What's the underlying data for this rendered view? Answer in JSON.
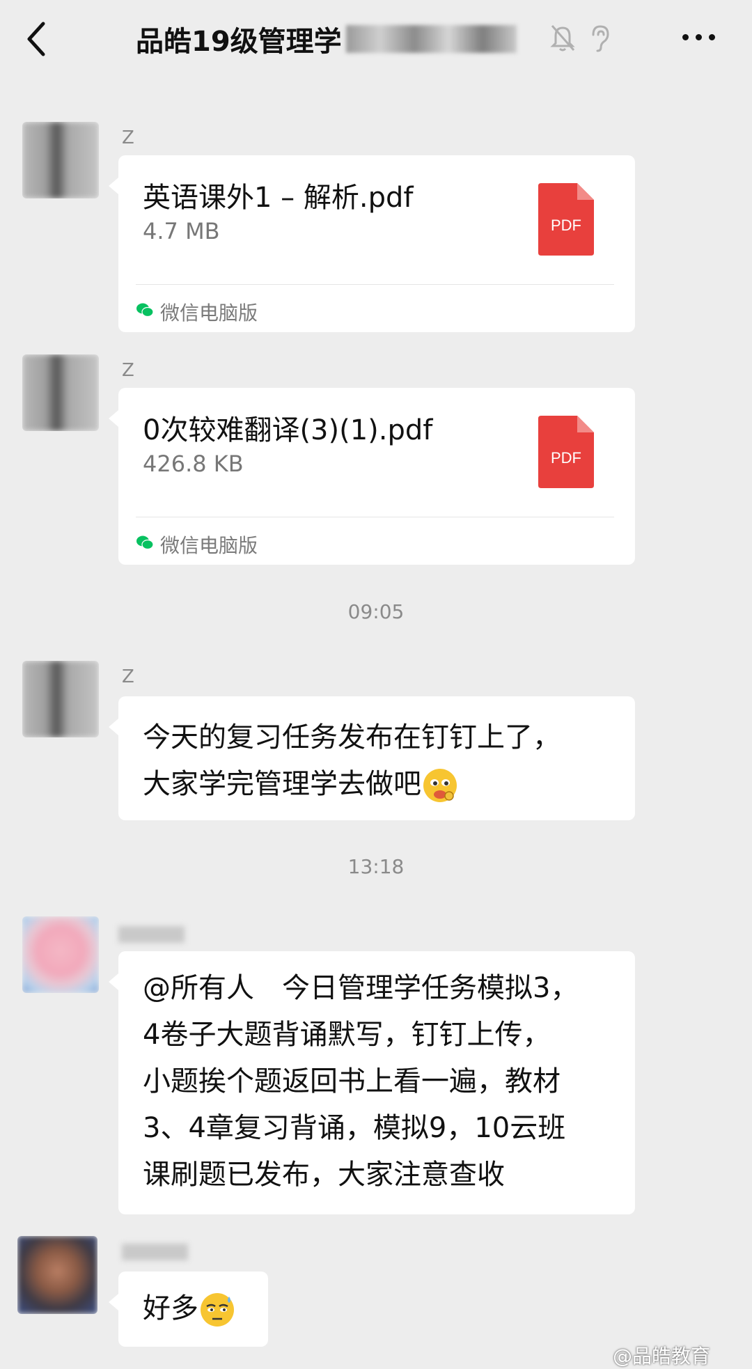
{
  "header": {
    "title": "品皓19级管理学"
  },
  "messages": [
    {
      "sender": "Z",
      "file_name": "英语课外1 – 解析.pdf",
      "file_size": "4.7 MB",
      "file_type": "PDF",
      "source": "微信电脑版"
    },
    {
      "sender": "Z",
      "file_name": "0次较难翻译(3)(1).pdf",
      "file_size": "426.8 KB",
      "file_type": "PDF",
      "source": "微信电脑版"
    },
    {
      "time": "09:05"
    },
    {
      "sender": "Z",
      "lines": [
        "今天的复习任务发布在钉钉上了，",
        "大家学完管理学去做吧"
      ]
    },
    {
      "time": "13:18"
    },
    {
      "lines": [
        "@所有人　今日管理学任务模拟3，",
        "4卷子大题背诵默写，钉钉上传，",
        "小题挨个题返回书上看一遍，教材",
        "3、4章复习背诵，模拟9，10云班",
        "课刷题已发布，大家注意查收"
      ]
    },
    {
      "text": "好多"
    }
  ],
  "watermark": "@品皓教育",
  "colors": {
    "background": "#ededed",
    "bubble": "#ffffff",
    "pdf_red": "#e8403d",
    "wechat_green": "#07c160"
  },
  "icons": [
    "back-arrow-icon",
    "mute-bell-icon",
    "ear-icon",
    "more-icon",
    "pdf-file-icon",
    "wechat-icon",
    "emoji-icon"
  ]
}
